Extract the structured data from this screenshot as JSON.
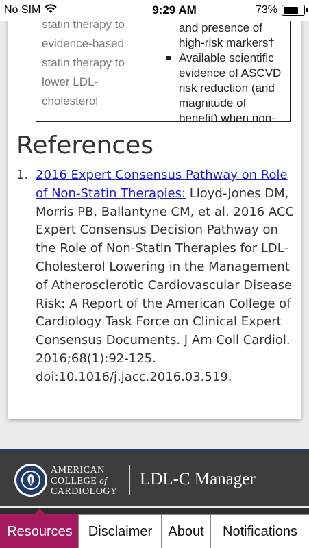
{
  "status_bar": {
    "carrier": "No SIM",
    "time": "9:29 AM",
    "battery_percent": "73%",
    "battery_level": 0.73,
    "wifi_icon": "wifi-icon"
  },
  "table": {
    "left_column_lines": [
      "statin therapy to",
      "evidence-based",
      "statin therapy to",
      "lower LDL-",
      "cholesterol"
    ],
    "right_column": {
      "first_line": "and presence of",
      "second_line": "high-risk markers†",
      "bullet_lines": [
        "Available scientific",
        "evidence of ASCVD",
        "risk reduction (and",
        "magnitude of",
        "benefit) when non-"
      ]
    }
  },
  "references": {
    "heading": "References",
    "items": [
      {
        "number": "1.",
        "link_text": "2016 Expert Consensus Pathway on Role of Non-Statin Therapies:",
        "citation": " Lloyd-Jones DM, Morris PB, Ballantyne CM, et al. 2016 ACC Expert Consensus Decision Pathway on the Role of Non-Statin Therapies for LDL-Cholesterol Lowering in the Management of Atherosclerotic Cardiovascular Disease Risk: A Report of the American College of Cardiology Task Force on Clinical Expert Consensus Documents. J Am Coll Cardiol. 2016;68(1):92-125. doi:10.1016/j.jacc.2016.03.519."
      }
    ]
  },
  "brand": {
    "org_line1": "AMERICAN",
    "org_line2_a": "COLLEGE",
    "org_line2_b": "of",
    "org_line3": "CARDIOLOGY",
    "app_name": "LDL-C Manager",
    "seal_icon": "acc-seal-icon"
  },
  "tabs": [
    {
      "label": "Resources",
      "active": true
    },
    {
      "label": "Disclaimer",
      "active": false
    },
    {
      "label": "About",
      "active": false
    },
    {
      "label": "Notifications",
      "active": false
    }
  ],
  "colors": {
    "accent": "#a51a5f",
    "link": "#1a1ad6",
    "banner": "#3d3d3d",
    "banner_rule": "#1f3a6b"
  }
}
